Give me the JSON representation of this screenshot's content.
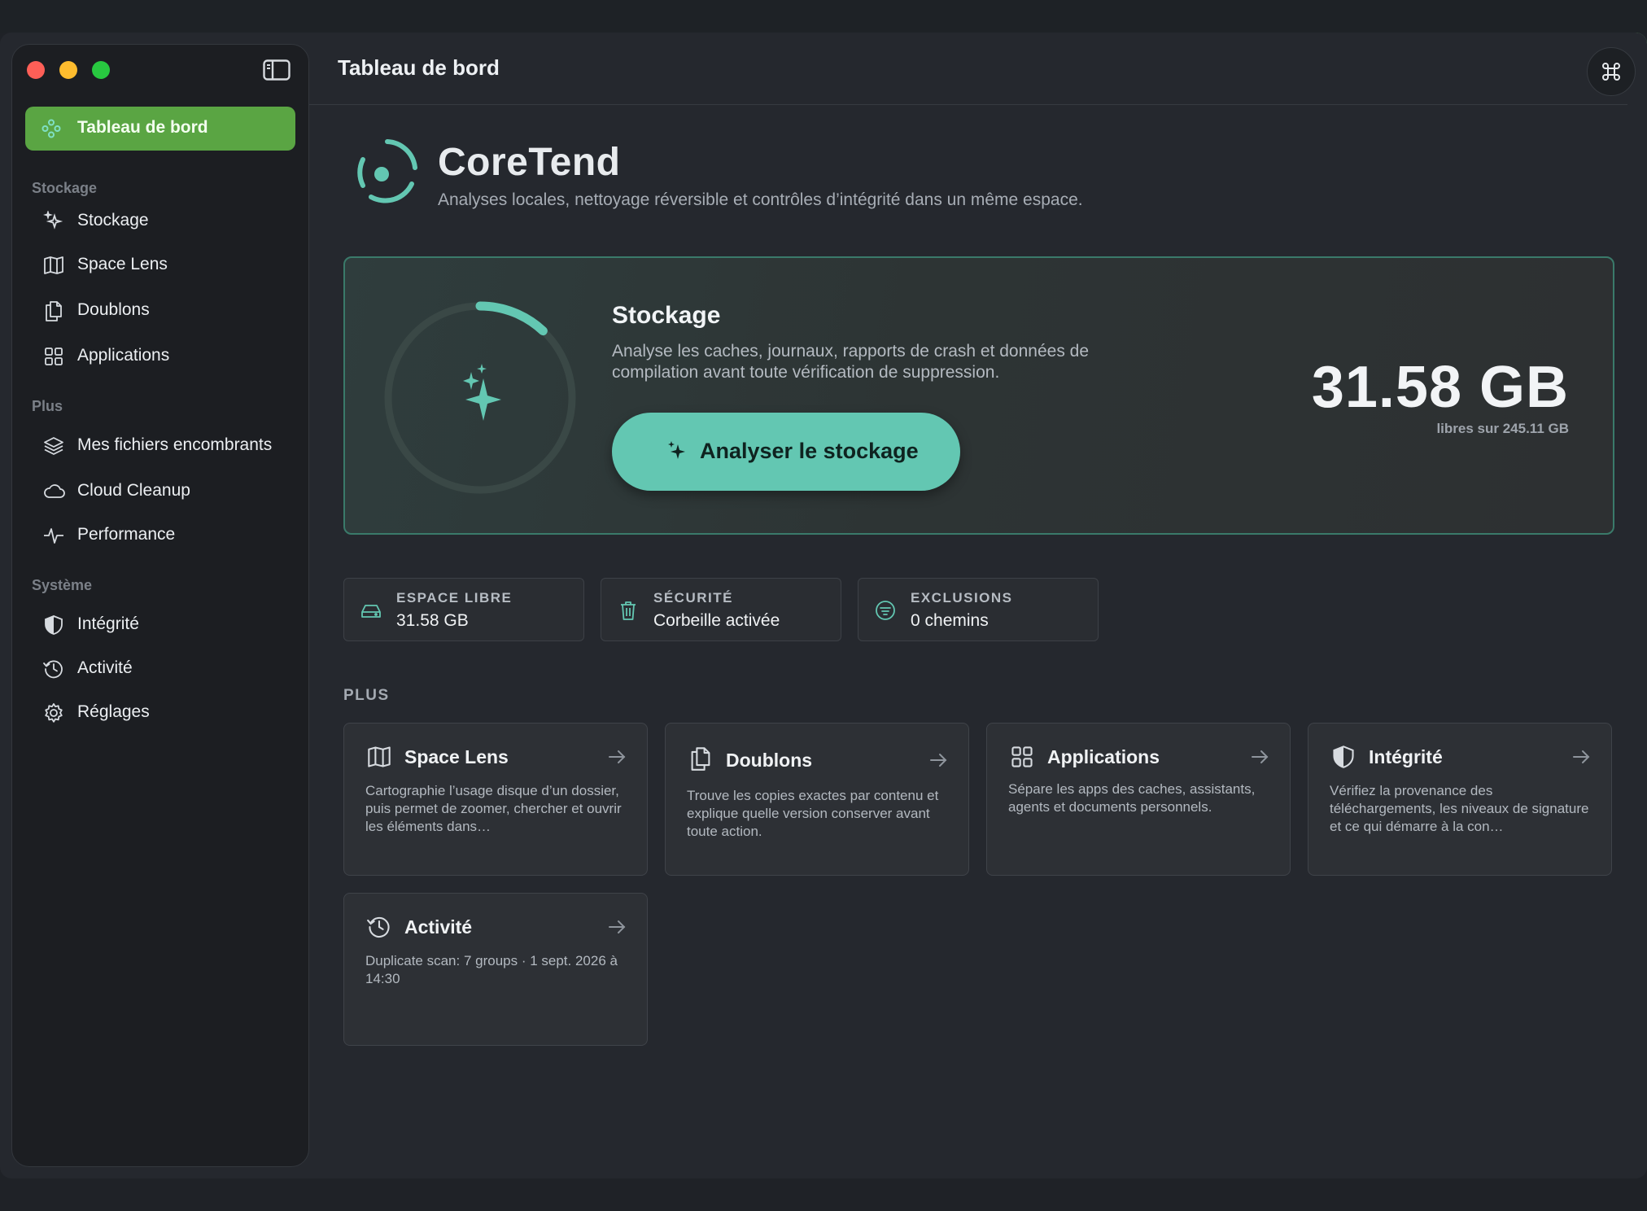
{
  "window": {
    "title": "Tableau de bord"
  },
  "sidebar": {
    "active": {
      "label": "Tableau de bord",
      "icon": "dashboard-icon"
    },
    "sections": [
      {
        "heading": "Stockage",
        "items": [
          {
            "label": "Stockage",
            "icon": "sparkles-icon"
          },
          {
            "label": "Space Lens",
            "icon": "map-icon"
          },
          {
            "label": "Doublons",
            "icon": "copy-icon"
          },
          {
            "label": "Applications",
            "icon": "grid-icon"
          }
        ]
      },
      {
        "heading": "Plus",
        "items": [
          {
            "label": "Mes fichiers encombrants",
            "icon": "layers-icon"
          },
          {
            "label": "Cloud Cleanup",
            "icon": "cloud-icon"
          },
          {
            "label": "Performance",
            "icon": "activity-icon"
          }
        ]
      },
      {
        "heading": "Système",
        "items": [
          {
            "label": "Intégrité",
            "icon": "shield-icon"
          },
          {
            "label": "Activité",
            "icon": "history-icon"
          },
          {
            "label": "Réglages",
            "icon": "gear-icon"
          }
        ]
      }
    ]
  },
  "brand": {
    "name": "CoreTend",
    "tagline": "Analyses locales, nettoyage réversible et contrôles d’intégrité dans un même espace."
  },
  "hero": {
    "title": "Stockage",
    "description": "Analyse les caches, journaux, rapports de crash et données de compilation avant toute vérification de suppression.",
    "button_label": "Analyser le stockage",
    "value": "31.58 GB",
    "caption": "libres sur 245.11 GB",
    "ring_progress": 0.12
  },
  "stats": [
    {
      "key": "ESPACE LIBRE",
      "value": "31.58 GB",
      "icon": "drive-icon"
    },
    {
      "key": "SÉCURITÉ",
      "value": "Corbeille activée",
      "icon": "trash-icon"
    },
    {
      "key": "EXCLUSIONS",
      "value": "0 chemins",
      "icon": "filter-icon"
    }
  ],
  "plus_heading": "PLUS",
  "cards": [
    {
      "title": "Space Lens",
      "desc": "Cartographie l’usage disque d’un dossier, puis permet de zoomer, chercher et ouvrir les éléments dans…",
      "icon": "map-icon"
    },
    {
      "title": "Doublons",
      "desc": "Trouve les copies exactes par contenu et explique quelle version conserver avant toute action.",
      "icon": "copy-icon"
    },
    {
      "title": "Applications",
      "desc": "Sépare les apps des caches, assistants, agents et documents personnels.",
      "icon": "grid-icon"
    },
    {
      "title": "Intégrité",
      "desc": "Vérifiez la provenance des téléchargements, les niveaux de signature et ce qui démarre à la con…",
      "icon": "shield-icon"
    },
    {
      "title": "Activité",
      "desc": "Duplicate scan: 7 groups · 1 sept. 2026 à 14:30",
      "icon": "history-icon"
    }
  ],
  "colors": {
    "accent": "#63c7b2",
    "active_nav": "#5aa543",
    "background": "#25282e"
  }
}
